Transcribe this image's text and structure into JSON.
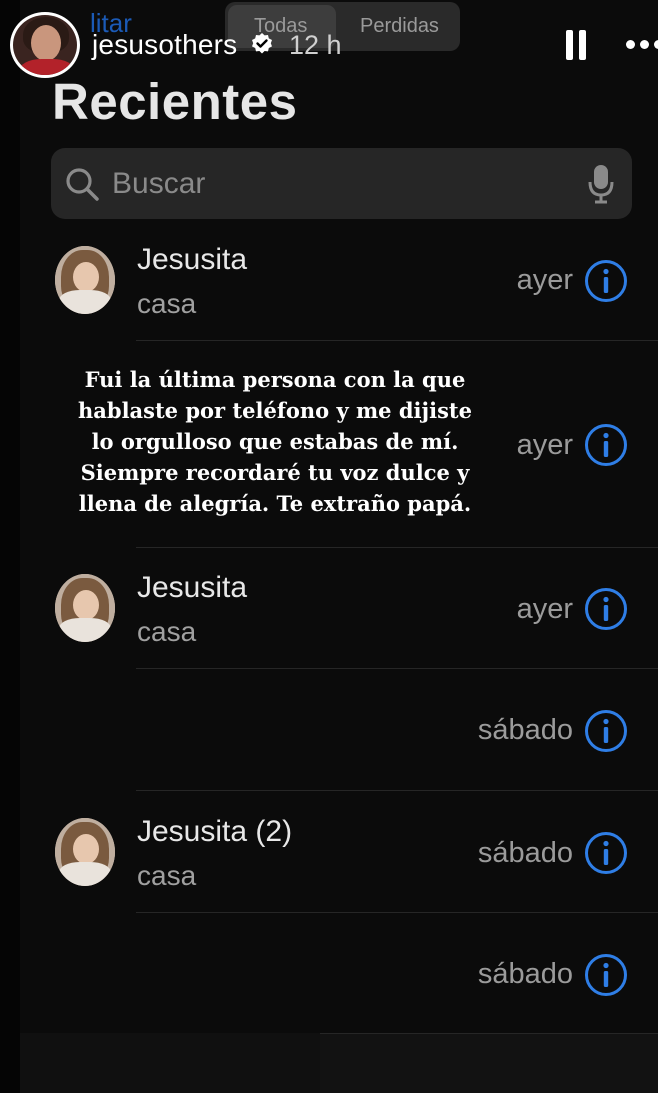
{
  "story": {
    "username": "jesusothers",
    "time": "12 h"
  },
  "header": {
    "edit_label": "litar",
    "segments": [
      "Todas",
      "Perdidas"
    ],
    "title": "Recientes"
  },
  "search": {
    "placeholder": "Buscar"
  },
  "calls": [
    {
      "name": "Jesusita",
      "label": "casa",
      "when": "ayer"
    },
    {
      "name": "",
      "label": "",
      "when": "ayer"
    },
    {
      "name": "Jesusita",
      "label": "casa",
      "when": "ayer"
    },
    {
      "name": "",
      "label": "",
      "when": "sábado"
    },
    {
      "name": "Jesusita (2)",
      "label": "casa",
      "when": "sábado"
    },
    {
      "name": "",
      "label": "",
      "when": "sábado"
    }
  ],
  "overlay": {
    "lines": [
      "Fui la última persona con la que",
      "hablaste por teléfono y me dijiste",
      "lo orgulloso que estabas de mí.",
      "Siempre recordaré tu voz dulce y",
      "llena de alegría. Te extraño papá."
    ]
  },
  "colors": {
    "accent_blue": "#2f7ee6",
    "background": "#0b0b0b"
  }
}
